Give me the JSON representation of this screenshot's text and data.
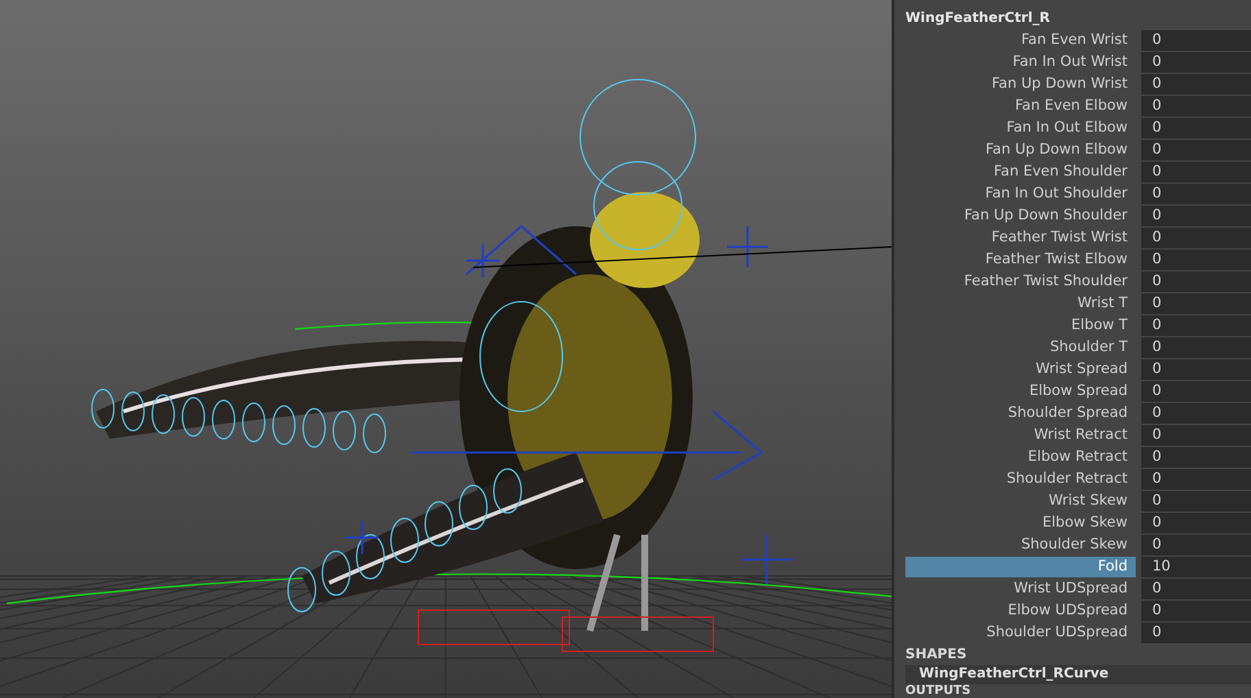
{
  "channel_box": {
    "node_name": "WingFeatherCtrl_R",
    "attributes": [
      {
        "label": "Fan Even Wrist",
        "value": "0",
        "selected": false
      },
      {
        "label": "Fan In Out Wrist",
        "value": "0",
        "selected": false
      },
      {
        "label": "Fan Up Down Wrist",
        "value": "0",
        "selected": false
      },
      {
        "label": "Fan Even Elbow",
        "value": "0",
        "selected": false
      },
      {
        "label": "Fan In Out Elbow",
        "value": "0",
        "selected": false
      },
      {
        "label": "Fan Up Down Elbow",
        "value": "0",
        "selected": false
      },
      {
        "label": "Fan Even Shoulder",
        "value": "0",
        "selected": false
      },
      {
        "label": "Fan In Out Shoulder",
        "value": "0",
        "selected": false
      },
      {
        "label": "Fan Up Down Shoulder",
        "value": "0",
        "selected": false
      },
      {
        "label": "Feather Twist Wrist",
        "value": "0",
        "selected": false
      },
      {
        "label": "Feather Twist Elbow",
        "value": "0",
        "selected": false
      },
      {
        "label": "Feather Twist Shoulder",
        "value": "0",
        "selected": false
      },
      {
        "label": "Wrist T",
        "value": "0",
        "selected": false
      },
      {
        "label": "Elbow T",
        "value": "0",
        "selected": false
      },
      {
        "label": "Shoulder T",
        "value": "0",
        "selected": false
      },
      {
        "label": "Wrist Spread",
        "value": "0",
        "selected": false
      },
      {
        "label": "Elbow Spread",
        "value": "0",
        "selected": false
      },
      {
        "label": "Shoulder Spread",
        "value": "0",
        "selected": false
      },
      {
        "label": "Wrist Retract",
        "value": "0",
        "selected": false
      },
      {
        "label": "Elbow Retract",
        "value": "0",
        "selected": false
      },
      {
        "label": "Shoulder Retract",
        "value": "0",
        "selected": false
      },
      {
        "label": "Wrist Skew",
        "value": "0",
        "selected": false
      },
      {
        "label": "Elbow Skew",
        "value": "0",
        "selected": false
      },
      {
        "label": "Shoulder Skew",
        "value": "0",
        "selected": false
      },
      {
        "label": "Fold",
        "value": "10",
        "selected": true
      },
      {
        "label": "Wrist UDSpread",
        "value": "0",
        "selected": false
      },
      {
        "label": "Elbow UDSpread",
        "value": "0",
        "selected": false
      },
      {
        "label": "Shoulder UDSpread",
        "value": "0",
        "selected": false
      }
    ],
    "shapes_heading": "SHAPES",
    "shapes": [
      "WingFeatherCtrl_RCurve"
    ],
    "outputs_heading": "OUTPUTS"
  }
}
